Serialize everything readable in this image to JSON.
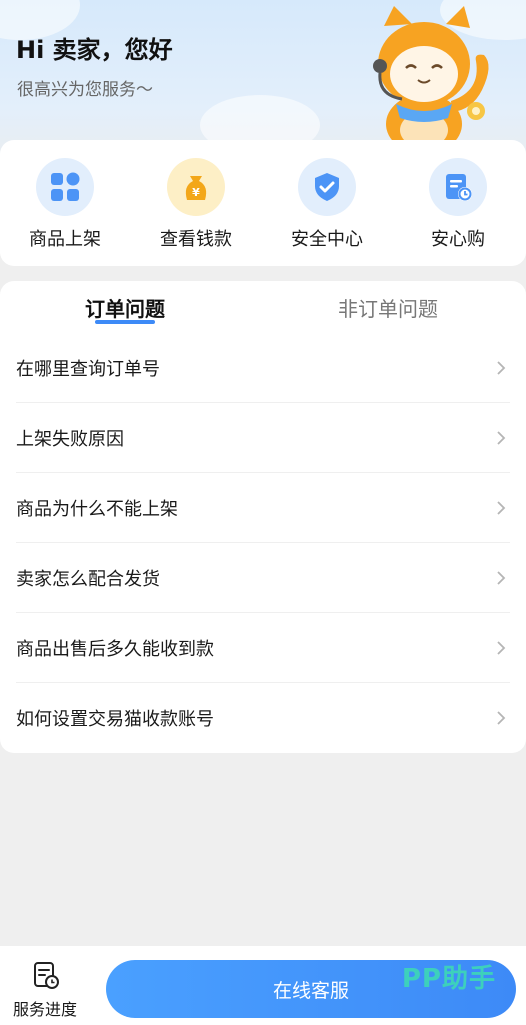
{
  "header": {
    "title": "Hi 卖家，您好",
    "subtitle": "很高兴为您服务～"
  },
  "quick_actions": [
    {
      "label": "商品上架",
      "icon": "grid-icon"
    },
    {
      "label": "查看钱款",
      "icon": "money-bag-icon"
    },
    {
      "label": "安全中心",
      "icon": "shield-check-icon"
    },
    {
      "label": "安心购",
      "icon": "document-clock-icon"
    }
  ],
  "tabs": {
    "active": "订单问题",
    "inactive": "非订单问题"
  },
  "faq": [
    "在哪里查询订单号",
    "上架失败原因",
    "商品为什么不能上架",
    "卖家怎么配合发货",
    "商品出售后多久能收到款",
    "如何设置交易猫收款账号"
  ],
  "bottom": {
    "progress_label": "服务进度",
    "service_button": "在线客服",
    "watermark": "PP助手"
  },
  "colors": {
    "accent": "#3d8af7",
    "money_bg": "#fdefc6",
    "icon_bg": "#e2eefc"
  }
}
